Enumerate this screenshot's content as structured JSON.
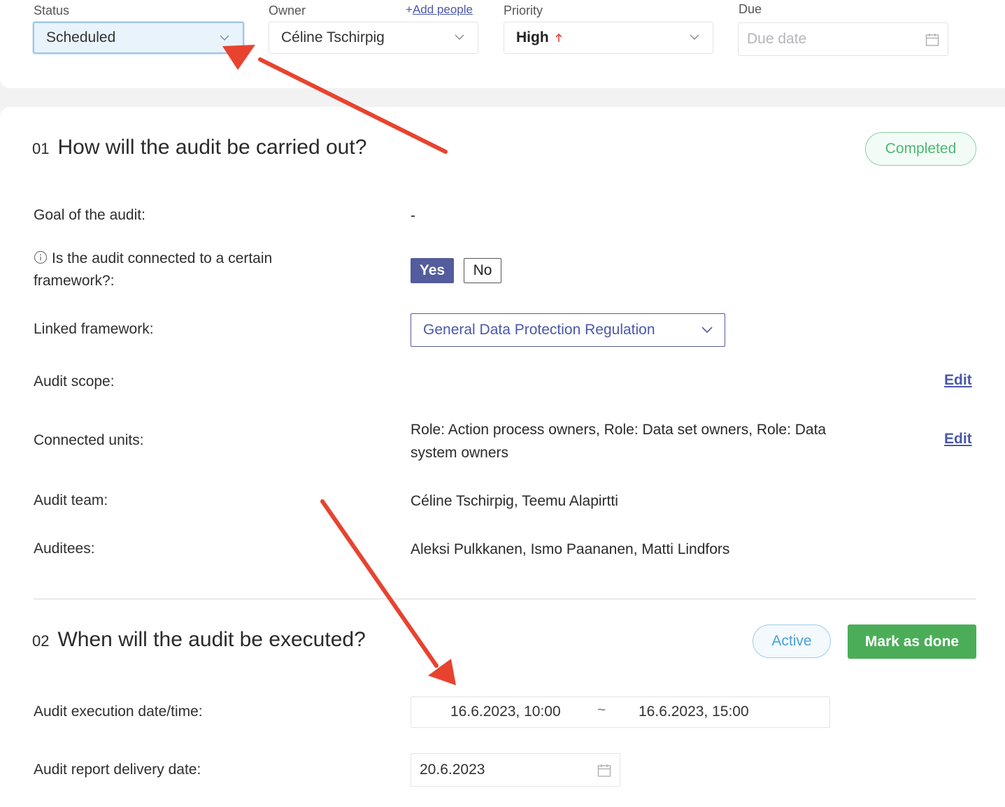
{
  "header": {
    "status": {
      "label": "Status",
      "value": "Scheduled"
    },
    "owner": {
      "label": "Owner",
      "add_people_plus": "+",
      "add_people": "Add people",
      "value": "Céline Tschirpig"
    },
    "priority": {
      "label": "Priority",
      "value": "High",
      "icon": "arrow-up-icon",
      "icon_color": "#e0413a"
    },
    "due": {
      "label": "Due",
      "placeholder": "Due date"
    }
  },
  "section1": {
    "number": "01",
    "title": "How will the audit be carried out?",
    "badge": "Completed",
    "rows": {
      "goal": {
        "label": "Goal of the audit:",
        "value": "-"
      },
      "connected": {
        "label": "Is the audit connected to a certain framework?:",
        "yes": "Yes",
        "no": "No",
        "selected": "Yes"
      },
      "framework": {
        "label": "Linked framework:",
        "value": "General Data Protection Regulation"
      },
      "scope": {
        "label": "Audit scope:",
        "edit": "Edit"
      },
      "units": {
        "label": "Connected units:",
        "value": "Role: Action process owners, Role: Data set owners, Role: Data system owners",
        "edit": "Edit"
      },
      "team": {
        "label": "Audit team:",
        "value": "Céline Tschirpig, Teemu Alapirtti"
      },
      "auditees": {
        "label": "Auditees:",
        "value": "Aleksi Pulkkanen, Ismo Paananen, Matti Lindfors"
      }
    }
  },
  "section2": {
    "number": "02",
    "title": "When will the audit be executed?",
    "badge": "Active",
    "mark_done": "Mark as done",
    "rows": {
      "execution": {
        "label": "Audit execution date/time:",
        "start": "16.6.2023, 10:00",
        "separator": "~",
        "end": "16.6.2023, 15:00"
      },
      "report": {
        "label": "Audit report delivery date:",
        "value": "20.6.2023"
      }
    }
  },
  "colors": {
    "accent": "#535c9c",
    "link": "#4a58a8",
    "completed": "#4cb873",
    "active": "#4aa0d6",
    "done_button": "#4cad59",
    "annotation_arrow": "#e8432f"
  }
}
